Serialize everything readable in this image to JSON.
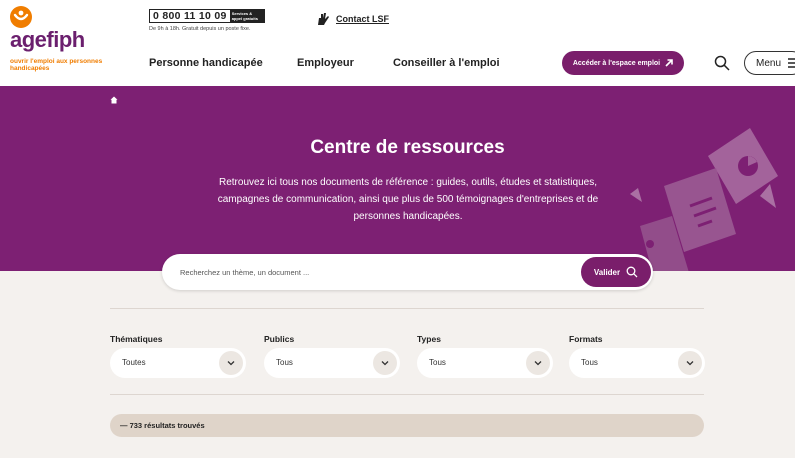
{
  "brand": {
    "name": "agefiph",
    "tagline": "ouvrir l'emploi aux personnes handicapées",
    "accent": "#7d2073",
    "orange": "#f07d00"
  },
  "phone": {
    "number": "0 800 11 10 09",
    "badge": "Services & appel gratuits",
    "hours": "De 9h à 18h. Gratuit depuis un poste fixe."
  },
  "lsf": {
    "label": "Contact LSF",
    "icon": "sign-language-icon"
  },
  "nav": {
    "items": [
      "Personne handicapée",
      "Employeur",
      "Conseiller à l'emploi"
    ],
    "cta": "Accéder à l'espace emploi",
    "menu": "Menu"
  },
  "hero": {
    "title": "Centre de ressources",
    "description": "Retrouvez ici tous nos documents de référence : guides, outils, études et statistiques, campagnes de communication, ainsi que plus de 500 témoignages d'entreprises et de personnes handicapées."
  },
  "search": {
    "placeholder": "Recherchez un thème, un document ...",
    "button": "Valider"
  },
  "filters": [
    {
      "label": "Thématiques",
      "value": "Toutes"
    },
    {
      "label": "Publics",
      "value": "Tous"
    },
    {
      "label": "Types",
      "value": "Tous"
    },
    {
      "label": "Formats",
      "value": "Tous"
    }
  ],
  "results": {
    "text": "— 733 résultats trouvés"
  }
}
